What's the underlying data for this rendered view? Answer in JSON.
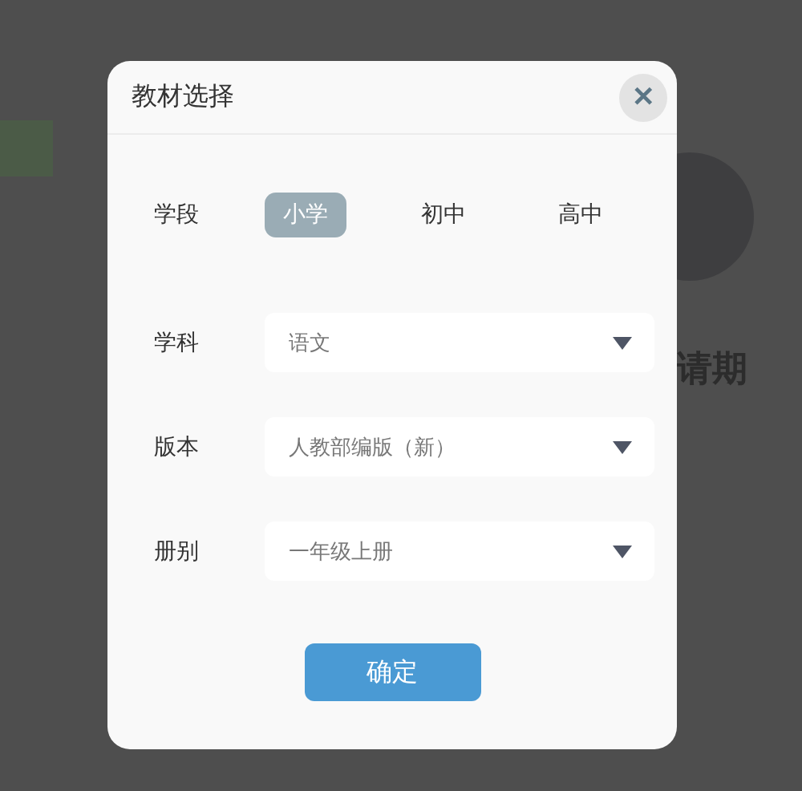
{
  "background": {
    "heading_fragment": "请期"
  },
  "dialog": {
    "title": "教材选择",
    "close_label": "✕",
    "stage": {
      "label": "学段",
      "options": [
        {
          "label": "小学",
          "selected": true
        },
        {
          "label": "初中",
          "selected": false
        },
        {
          "label": "高中",
          "selected": false
        }
      ]
    },
    "fields": [
      {
        "label": "学科",
        "value": "语文"
      },
      {
        "label": "版本",
        "value": "人教部编版（新）"
      },
      {
        "label": "册别",
        "value": "一年级上册"
      }
    ],
    "confirm": "确定"
  }
}
